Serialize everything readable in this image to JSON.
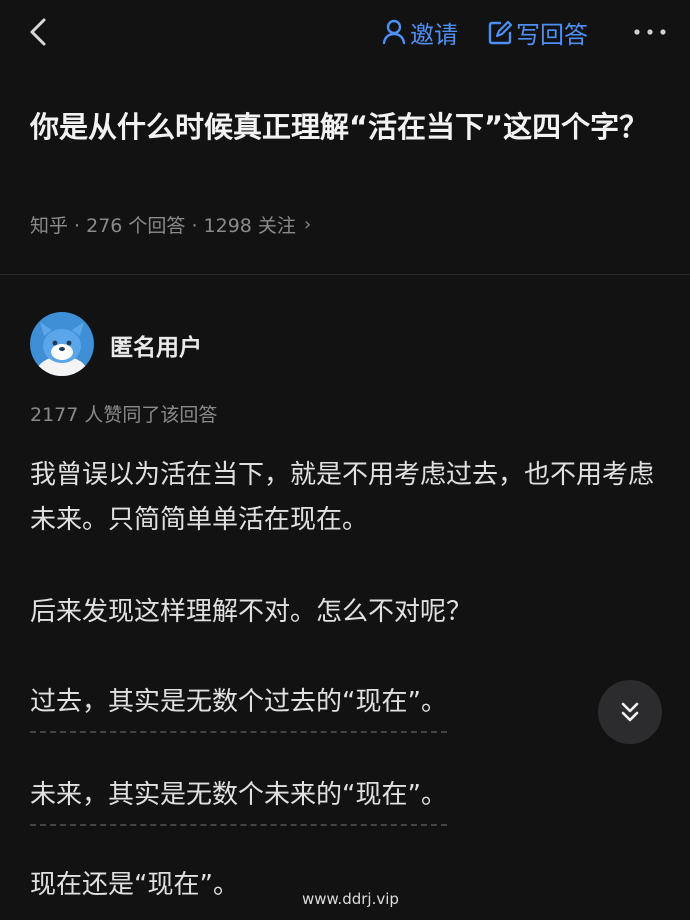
{
  "header": {
    "invite_label": "邀请",
    "write_label": "写回答"
  },
  "question": {
    "title": "你是从什么时候真正理解“活在当下”这四个字？",
    "source": "知乎",
    "answers": "276 个回答",
    "followers": "1298 关注",
    "meta_text": "知乎 · 276 个回答 · 1298 关注"
  },
  "answer": {
    "author": "匿名用户",
    "votes": "2177 人赞同了该回答",
    "paragraphs": [
      "我曾误以为活在当下，就是不用考虑过去，也不用考虑未来。只简简单单活在现在。",
      "后来发现这样理解不对。怎么不对呢？",
      "过去，其实是无数个过去的“现在”。",
      "未来，其实是无数个未来的“现在”。",
      "现在还是“现在”。"
    ]
  },
  "watermark": "www.ddrj.vip",
  "colors": {
    "background": "#121212",
    "accent": "#4d8ff5",
    "avatar_bg": "#3e8fd6"
  },
  "icons": {
    "back": "chevron-left-icon",
    "invite": "person-icon",
    "write": "edit-icon",
    "more": "more-icon",
    "scroll": "double-chevron-down-icon"
  }
}
